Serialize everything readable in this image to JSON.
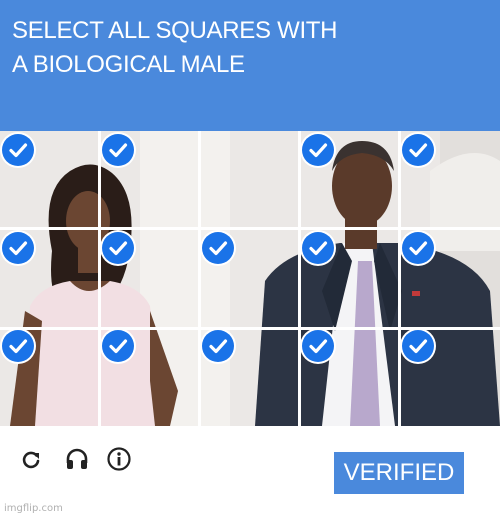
{
  "captcha": {
    "instruction_line1": "SELECT ALL SQUARES WITH",
    "instruction_line2": "A BIOLOGICAL MALE",
    "header_color": "#4a89dc",
    "grid": {
      "rows": 3,
      "columns": 5
    },
    "tiles": [
      {
        "row": 1,
        "col": 1,
        "selected": true
      },
      {
        "row": 1,
        "col": 2,
        "selected": true
      },
      {
        "row": 1,
        "col": 3,
        "selected": false
      },
      {
        "row": 1,
        "col": 4,
        "selected": true
      },
      {
        "row": 1,
        "col": 5,
        "selected": true
      },
      {
        "row": 2,
        "col": 1,
        "selected": true
      },
      {
        "row": 2,
        "col": 2,
        "selected": true
      },
      {
        "row": 2,
        "col": 3,
        "selected": true
      },
      {
        "row": 2,
        "col": 4,
        "selected": true
      },
      {
        "row": 2,
        "col": 5,
        "selected": true
      },
      {
        "row": 3,
        "col": 1,
        "selected": true
      },
      {
        "row": 3,
        "col": 2,
        "selected": true
      },
      {
        "row": 3,
        "col": 3,
        "selected": true
      },
      {
        "row": 3,
        "col": 4,
        "selected": true
      },
      {
        "row": 3,
        "col": 5,
        "selected": true
      }
    ],
    "check_color": "#1a73e8",
    "footer_icons": [
      "reload-icon",
      "headphones-icon",
      "info-icon"
    ],
    "verify_label": "VERIFIED"
  },
  "watermark": "imgflip.com"
}
